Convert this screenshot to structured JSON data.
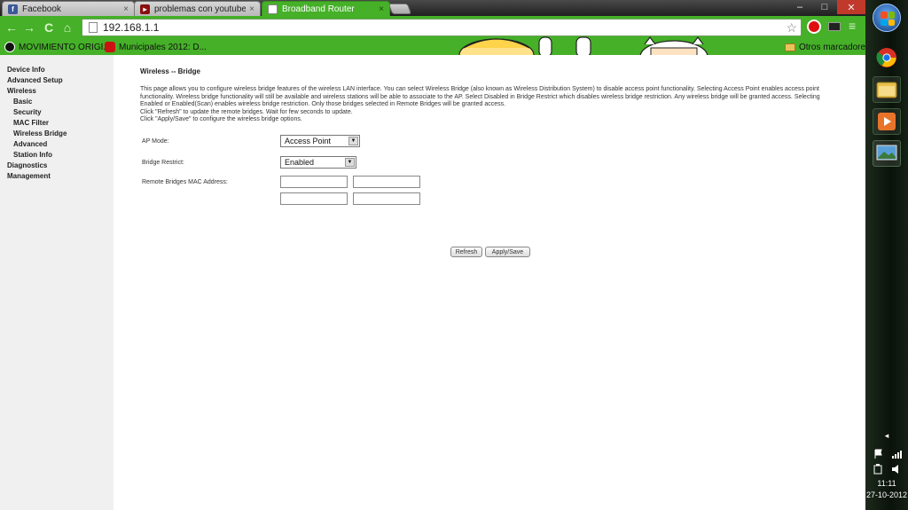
{
  "browser": {
    "tabs": [
      {
        "label": "Facebook",
        "icon": "facebook-icon",
        "icon_glyph": "f",
        "icon_color": "#3b5998",
        "active": false
      },
      {
        "label": "problemas con youtube y l",
        "icon": "youtube-icon",
        "icon_glyph": "▸",
        "icon_color": "#8a1010",
        "active": false
      },
      {
        "label": "Broadband Router",
        "icon": "page-icon",
        "icon_glyph": "",
        "icon_color": "#ffffff",
        "active": true
      }
    ],
    "close_glyph": "×",
    "window_controls": {
      "minimize": "–",
      "maximize": "□",
      "close": "✕"
    },
    "nav": {
      "back": "←",
      "forward": "→",
      "reload": "C",
      "home": "⌂"
    },
    "address": "192.168.1.1",
    "star_glyph": "☆",
    "menu_glyph": "≡",
    "bookmarks": [
      {
        "label": "MOVIMIENTO ORIGI...",
        "icon": "movimiento-icon",
        "icon_color": "#111111"
      },
      {
        "label": "Municipales 2012: D...",
        "icon": "youtube-icon",
        "icon_color": "#cc1111"
      }
    ],
    "other_bookmarks": "Otros marcadores",
    "theme_color": "#45b028"
  },
  "sidebar": {
    "items": [
      {
        "label": "Device Info",
        "sub": false
      },
      {
        "label": "Advanced Setup",
        "sub": false
      },
      {
        "label": "Wireless",
        "sub": false
      },
      {
        "label": "Basic",
        "sub": true
      },
      {
        "label": "Security",
        "sub": true
      },
      {
        "label": "MAC Filter",
        "sub": true
      },
      {
        "label": "Wireless Bridge",
        "sub": true
      },
      {
        "label": "Advanced",
        "sub": true
      },
      {
        "label": "Station Info",
        "sub": true
      },
      {
        "label": "Diagnostics",
        "sub": false
      },
      {
        "label": "Management",
        "sub": false
      }
    ]
  },
  "main": {
    "heading": "Wireless -- Bridge",
    "description": [
      "This page allows you to configure wireless bridge features of the wireless LAN interface. You can select Wireless Bridge (also known as Wireless Distribution System) to disable access point functionality. Selecting Access Point enables access point functionality. Wireless bridge functionality will still be available and wireless stations will be able to associate to the AP. Select Disabled in Bridge Restrict which disables wireless bridge restriction. Any wireless bridge will be granted access. Selecting Enabled or Enabled(Scan) enables wireless bridge restriction. Only those bridges selected in Remote Bridges will be granted access.",
      "Click \"Refresh\" to update the remote bridges. Wait for few seconds to update.",
      "Click \"Apply/Save\" to configure the wireless bridge options."
    ],
    "ap_mode": {
      "label": "AP Mode:",
      "value": "Access Point"
    },
    "bridge_restrict": {
      "label": "Bridge Restrict:",
      "value": "Enabled"
    },
    "remote_bridges": {
      "label": "Remote Bridges MAC Address:",
      "values": [
        "",
        "",
        "",
        ""
      ]
    },
    "dropdown_glyph": "▼",
    "buttons": {
      "refresh": "Refresh",
      "apply_save": "Apply/Save"
    }
  },
  "taskbar": {
    "apps": [
      {
        "name": "chrome-icon",
        "color": "#d93025"
      },
      {
        "name": "file-explorer-icon",
        "color": "#e8c04a"
      },
      {
        "name": "media-player-icon",
        "color": "#e8742a"
      },
      {
        "name": "desktop-icon",
        "color": "#5aa0d8"
      }
    ],
    "tray_arrow": "◂",
    "time": "11:11",
    "date": "27-10-2012"
  }
}
